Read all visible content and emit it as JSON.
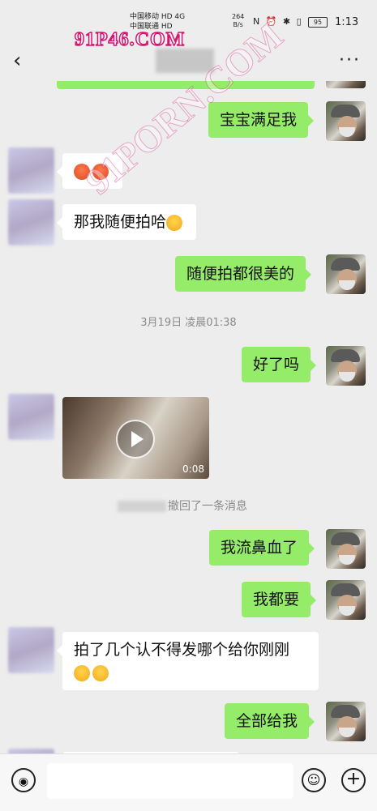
{
  "status_bar": {
    "carrier_1": "中国移动 HD 4G",
    "carrier_2": "中国联通 HD",
    "net_speed": "264",
    "net_unit": "B/s",
    "icons": "N ⏰ ✱ ▯",
    "battery": "95",
    "time": "1:13"
  },
  "watermark": {
    "top": "91P46.COM",
    "diagonal": "91PORN.COM"
  },
  "header": {
    "back_icon": "‹",
    "more_icon": "···"
  },
  "messages": {
    "m1_text": "宝宝满足我",
    "m2_emoji": "red-face-emoji",
    "m3_text": "那我随便拍哈",
    "m4_text": "随便拍都很美的",
    "timestamp": "3月19日 凌晨01:38",
    "m5_text": "好了吗",
    "video_duration": "0:08",
    "recall_text": "撤回了一条消息",
    "m6_text": "我流鼻血了",
    "m7_text": "我都要",
    "m8_text": "拍了几个认不得发哪个给你刚刚",
    "m9_text": "全部给我"
  },
  "input_bar": {
    "voice_icon": "voice-icon",
    "emoji_icon": "emoji-icon",
    "plus_icon": "plus-icon"
  },
  "colors": {
    "sent_bubble": "#95ec69",
    "received_bubble": "#ffffff",
    "background": "#ededed"
  }
}
